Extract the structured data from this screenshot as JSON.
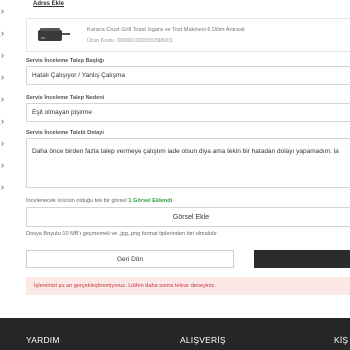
{
  "header": {
    "address_link": "Adres Ekle"
  },
  "product": {
    "name": "Karaca Crust Grill Toast Izgara ve Tost Makinesi 6 Dilim Antrasit",
    "code": "Ürün Kodu: 000001000155398001",
    "image_icon": "toaster-grill-icon"
  },
  "form": {
    "title_label": "Servis İnceleme Talep Başlığı",
    "title_value": "Hatalı Çalışıyor / Yanlış Çalışma",
    "reason_label": "Servis İnceleme Talep Nedeni",
    "reason_value": "Eşit olmayan pişirme",
    "detail_label": "Servis İnceleme Talebi Detayı",
    "detail_value": "Daha önce birden fazla talep vermeye çalıştım iade olsun diya ama tekin bir hatadan dolayı yapamadım. la"
  },
  "upload": {
    "hint_prefix": "İncelenecek ürünün olduğu tek bir görsel",
    "hint_status": "1 Görsel Eklendi",
    "button_label": "Görsel Ekle",
    "size_note": "Dosya Boyutu 10 MB'ı geçmemeli ve .jpg,.png format tiplerinden biri olmalıdır."
  },
  "actions": {
    "back_label": "Geri Dön"
  },
  "alert": {
    "message": "İşleminizi şu an gerçekleştiremiyoruz. Lütfen daha sonra tekrar deneyiniz."
  },
  "footer": {
    "col1": "YARDIM",
    "col2": "ALIŞVERİŞ",
    "col3": "KİŞ"
  },
  "colors": {
    "accent_green": "#2e9e3f",
    "alert_bg": "#fde8e8",
    "alert_text": "#c03a3a",
    "footer_bg": "#262626",
    "submit_bg": "#2b2b2b"
  }
}
